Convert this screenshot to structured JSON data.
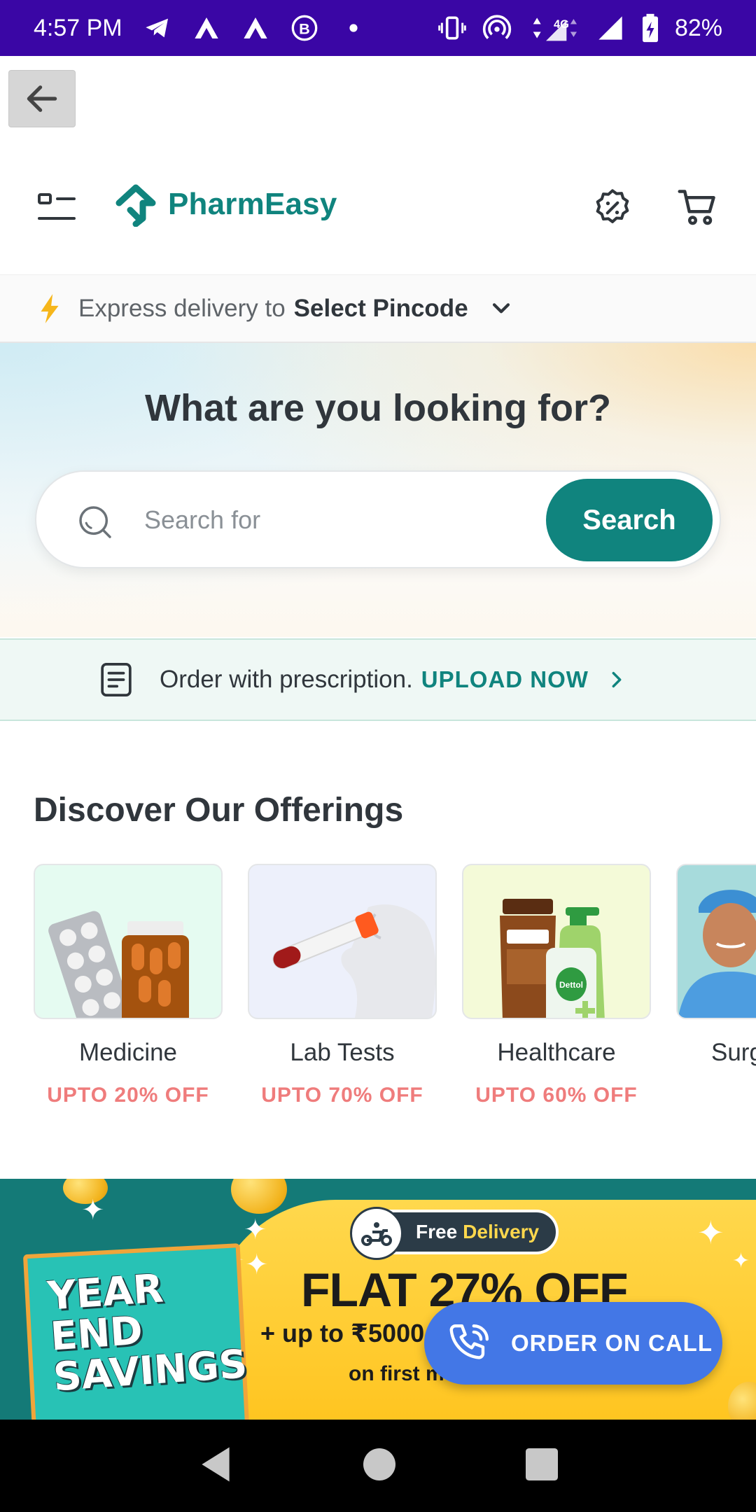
{
  "status_bar": {
    "time": "4:57 PM",
    "network": "4G",
    "battery": "82%"
  },
  "header": {
    "logo_text": "PharmEasy",
    "brand_color": "#10847e"
  },
  "delivery": {
    "label": "Express delivery to",
    "pincode": "Select Pincode"
  },
  "hero": {
    "title": "What are you looking for?",
    "search_placeholder": "Search for",
    "search_button": "Search"
  },
  "prescription": {
    "text": "Order with prescription.",
    "cta": "UPLOAD NOW"
  },
  "offerings": {
    "title": "Discover Our Offerings",
    "items": [
      {
        "name": "Medicine",
        "discount": "UPTO 20% OFF"
      },
      {
        "name": "Lab Tests",
        "discount": "UPTO 70% OFF"
      },
      {
        "name": "Healthcare",
        "discount": "UPTO 60% OFF"
      },
      {
        "name": "Surgeries",
        "discount": ""
      }
    ]
  },
  "banner": {
    "badge_text": "Free",
    "badge_highlight": "Delivery",
    "headline": "FLAT 27% OFF",
    "subline": "+ up to ₹5000",
    "line3": "on first m",
    "side_line1": "YEAR",
    "side_line2": "END",
    "side_line3": "SAVINGS"
  },
  "order_on_call": {
    "label": "ORDER ON CALL"
  }
}
